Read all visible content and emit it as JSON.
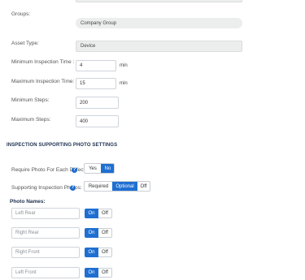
{
  "form": {
    "groups": {
      "label": "Groups:",
      "value": "Company Group"
    },
    "asset_type": {
      "label": "Asset Type:",
      "value": "Device"
    },
    "min_inspection_time": {
      "label": "Minimum Inspection Time :",
      "value": "4",
      "unit": "min"
    },
    "max_inspection_time": {
      "label": "Maximum Inspection Time:",
      "value": "15",
      "unit": "min"
    },
    "min_steps": {
      "label": "Minimum Steps:",
      "value": "200"
    },
    "max_steps": {
      "label": "Maximum Steps:",
      "value": "400"
    }
  },
  "photo_settings": {
    "title": "INSPECTION SUPPORTING PHOTO SETTINGS",
    "require_photo": {
      "label": "Require Photo For Each Defect:",
      "options": [
        "Yes",
        "No"
      ],
      "selected": "No"
    },
    "supporting_photos": {
      "label": "Supporting Inspection Photos:",
      "options": [
        "Required",
        "Optional",
        "Off"
      ],
      "selected": "Optional"
    },
    "photo_names_label": "Photo Names:",
    "photo_names": [
      {
        "placeholder": "Left Rear",
        "on_label": "On",
        "off_label": "Off",
        "state": "On"
      },
      {
        "placeholder": "Right Rear",
        "on_label": "On",
        "off_label": "Off",
        "state": "On"
      },
      {
        "placeholder": "Right Front",
        "on_label": "On",
        "off_label": "Off",
        "state": "On"
      },
      {
        "placeholder": "Left Front",
        "on_label": "On",
        "off_label": "Off",
        "state": "On"
      }
    ]
  },
  "colors": {
    "accent": "#1f6fd1",
    "section_title": "#1c2f4e",
    "readonly_bg": "#eceded"
  },
  "icons": {
    "help": "help-circle-icon"
  }
}
